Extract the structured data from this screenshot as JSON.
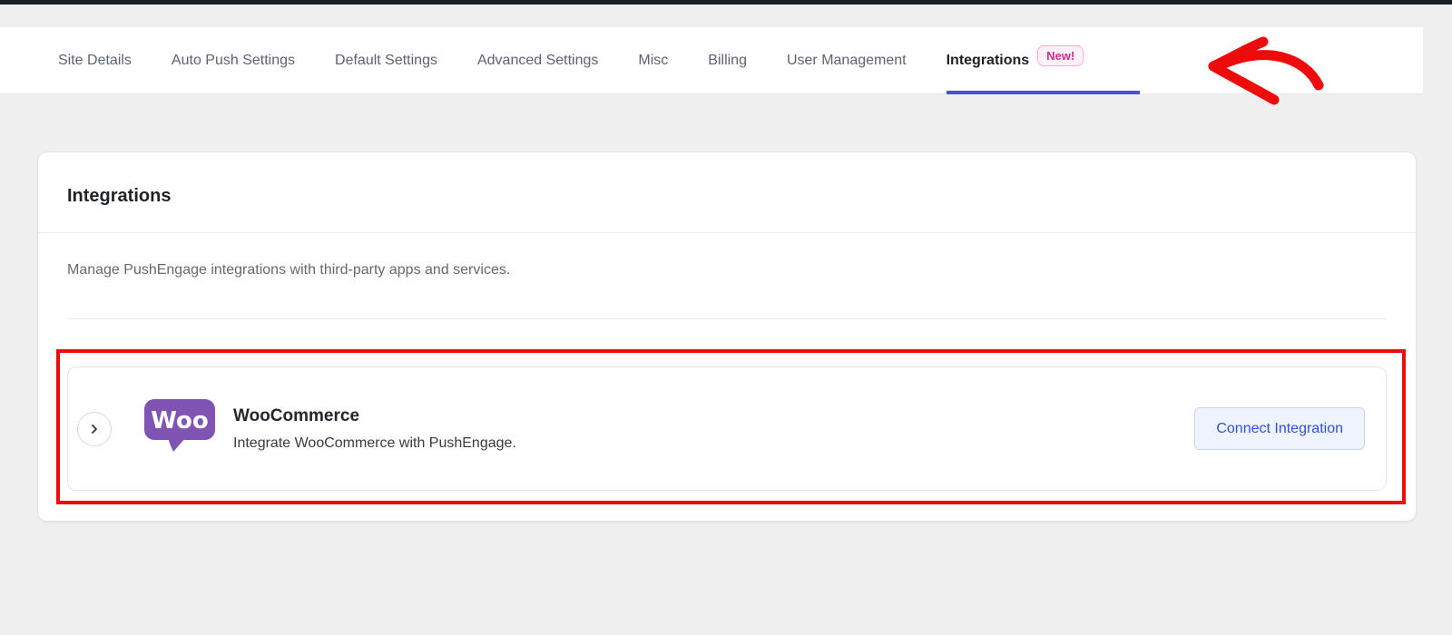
{
  "header": {
    "tabs": [
      {
        "label": "Site Details",
        "active": false
      },
      {
        "label": "Auto Push Settings",
        "active": false
      },
      {
        "label": "Default Settings",
        "active": false
      },
      {
        "label": "Advanced Settings",
        "active": false
      },
      {
        "label": "Misc",
        "active": false
      },
      {
        "label": "Billing",
        "active": false
      },
      {
        "label": "User Management",
        "active": false
      },
      {
        "label": "Integrations",
        "active": true,
        "badge": "New!"
      }
    ]
  },
  "card": {
    "title": "Integrations",
    "description": "Manage PushEngage integrations with third-party apps and services.",
    "integration": {
      "name": "WooCommerce",
      "description": "Integrate WooCommerce with PushEngage.",
      "logo_text": "Woo",
      "button_label": "Connect Integration"
    }
  },
  "annotations": {
    "red_arrow": "hand-drawn red arrow pointing left at the Integrations tab",
    "red_box": "red rectangle highlighting the WooCommerce integration row"
  },
  "colors": {
    "active_tab_underline": "#4a51d4",
    "badge_pink": "#d92a8e",
    "highlight_red": "#eb0c0c",
    "woo_purple": "#7f54b3",
    "button_blue": "#2e52d3",
    "background_gray": "#efefef"
  }
}
